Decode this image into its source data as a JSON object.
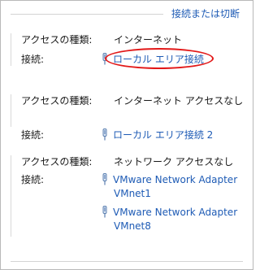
{
  "header": {
    "link_label": "接続または切断"
  },
  "networks": [
    {
      "access_type_label": "アクセスの種類:",
      "access_type_value": "インターネット",
      "connection_label": "接続:",
      "connections": [
        {
          "name": "ローカル エリア接続",
          "icon": "network-adapter-icon"
        }
      ]
    },
    {
      "access_type_label": "アクセスの種類:",
      "access_type_value": "インターネット アクセスなし",
      "connection_label": "接続:",
      "connections": [
        {
          "name": "ローカル エリア接続 2",
          "icon": "network-adapter-icon"
        }
      ]
    },
    {
      "access_type_label": "アクセスの種類:",
      "access_type_value": "ネットワーク アクセスなし",
      "connection_label": "接続:",
      "connections": [
        {
          "name": "VMware Network Adapter",
          "name_line2": "VMnet1",
          "icon": "network-adapter-icon"
        },
        {
          "name": "VMware Network Adapter",
          "name_line2": "VMnet8",
          "icon": "network-adapter-icon"
        }
      ]
    }
  ],
  "colors": {
    "link": "#1e5bb5",
    "highlight": "#e21818"
  }
}
